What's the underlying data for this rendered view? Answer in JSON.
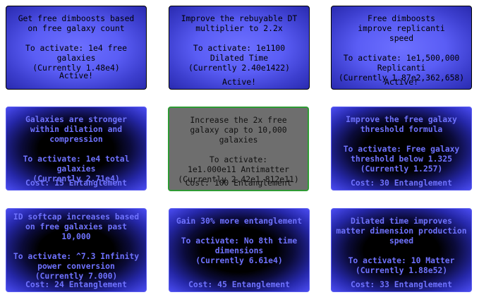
{
  "upgrades": [
    {
      "state": "active",
      "description": "Get free dimboosts based on free galaxy count",
      "requirement": "To activate: 1e4 free galaxies",
      "current": "(Currently 1.48e4)",
      "footer": "Active!"
    },
    {
      "state": "active",
      "description": "Improve the rebuyable DT multiplier to 2.2x",
      "requirement": "To activate: 1e1100 Dilated Time",
      "current": "(Currently 2.40e1422)",
      "footer": "Active!"
    },
    {
      "state": "active",
      "description": "Free dimboosts improve replicanti speed",
      "requirement": "To activate: 1e1,500,000 Replicanti",
      "current": "(Currently 1.87e2,362,658)",
      "footer": "Active!"
    },
    {
      "state": "locked",
      "description": "Galaxies are stronger within dilation and compression",
      "requirement": "To activate: 1e4 total galaxies",
      "current": "(Currently 2.71e4)",
      "footer": "Cost: 15 Entanglement"
    },
    {
      "state": "available",
      "description": "Increase the 2x free galaxy cap to 10,000 galaxies",
      "requirement": "To activate: 1e1.000e11 Antimatter",
      "current": "(Currently 2.42e1.812e11)",
      "footer": "Cost: 100 Entanglement"
    },
    {
      "state": "locked",
      "description": "Improve the free galaxy threshold formula",
      "requirement": "To activate: Free galaxy threshold below 1.325",
      "current": "(Currently 1.257)",
      "footer": "Cost: 30 Entanglement"
    },
    {
      "state": "locked",
      "description": "ID softcap increases based on free galaxies past 10,000",
      "requirement": "To activate: ^7.3 Infinity power conversion",
      "current": "(Currently 7.000)",
      "footer": "Cost: 24 Entanglement"
    },
    {
      "state": "locked",
      "description": "Gain 30% more entanglement",
      "requirement": "To activate: No 8th time dimensions",
      "current": "(Currently 6.61e4)",
      "footer": "Cost: 45 Entanglement"
    },
    {
      "state": "locked",
      "description": "Dilated time improves matter dimension production speed",
      "requirement": "To activate: 10 Matter",
      "current": "(Currently 1.88e52)",
      "footer": "Cost: 33 Entanglement"
    }
  ],
  "colors": {
    "active_bg": "#5a5df5",
    "locked_text": "#6f72ff",
    "available_bg": "#6e6e6e",
    "available_border": "#2e9a34"
  }
}
